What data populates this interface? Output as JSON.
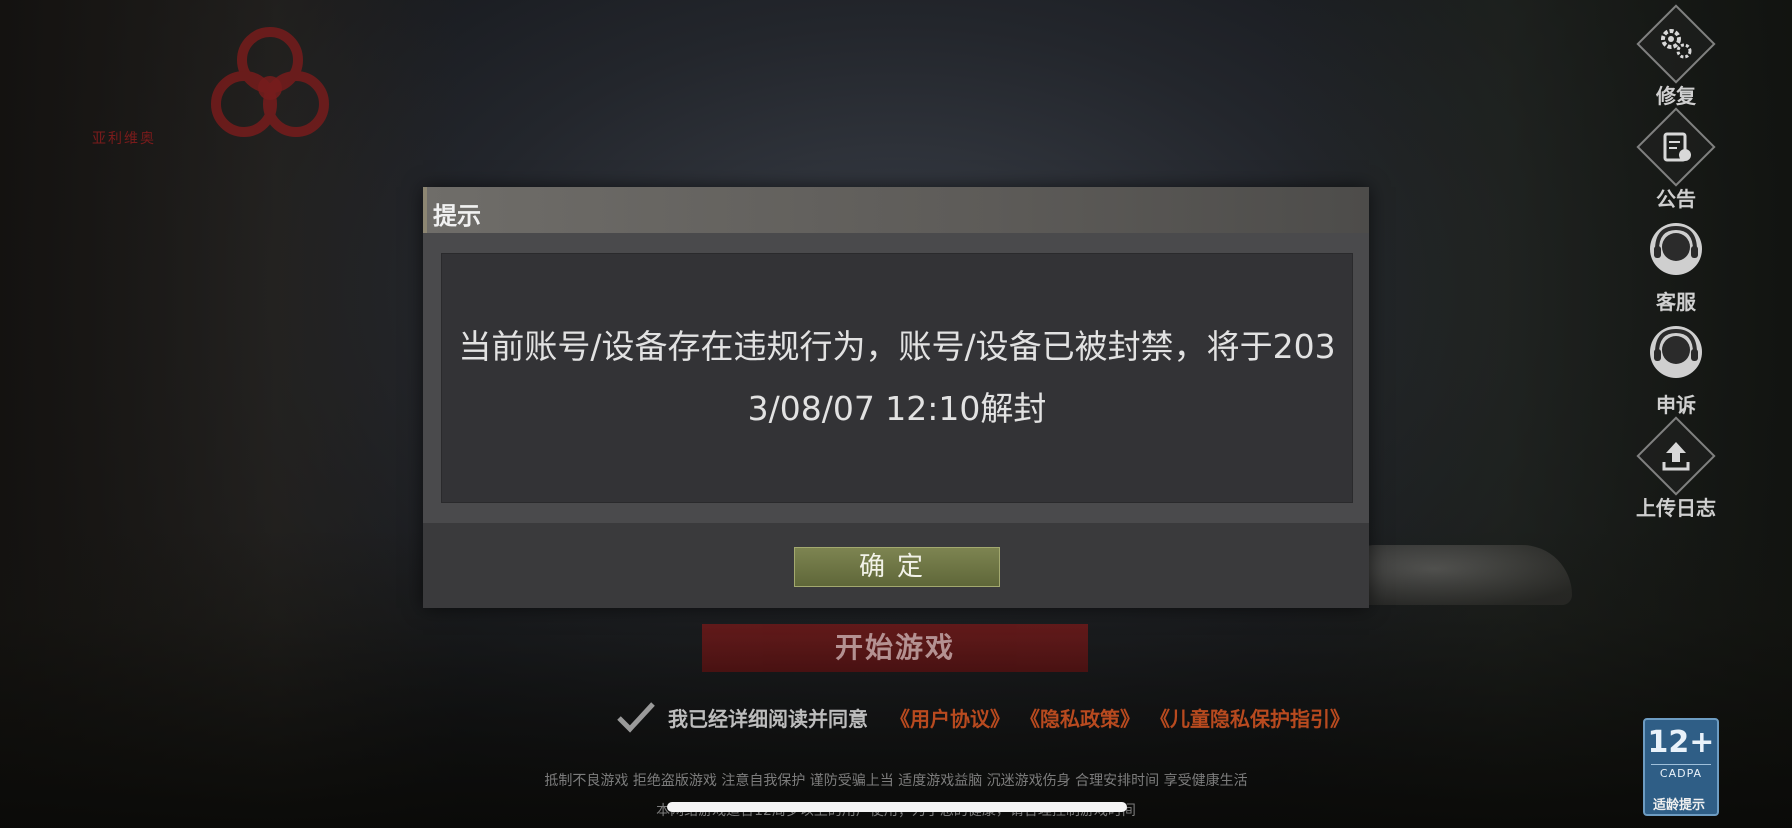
{
  "logo": {
    "text": "亚利维奥"
  },
  "side_menu": [
    {
      "label": "修复",
      "icon": "gears-icon"
    },
    {
      "label": "公告",
      "icon": "announcement-icon"
    },
    {
      "label": "客服",
      "icon": "headset-icon"
    },
    {
      "label": "申诉",
      "icon": "headset-icon"
    },
    {
      "label": "上传日志",
      "icon": "upload-icon"
    }
  ],
  "dialog": {
    "title": "提示",
    "message": "当前账号/设备存在违规行为，账号/设备已被封禁，将于2033/08/07 12:10解封",
    "confirm_label": "确定"
  },
  "start_button": {
    "label": "开始游戏"
  },
  "agreement": {
    "text": "我已经详细阅读并同意",
    "links": [
      "《用户协议》",
      "《隐私政策》",
      "《儿童隐私保护指引》"
    ]
  },
  "health_notice": {
    "line1": "抵制不良游戏 拒绝盗版游戏 注意自我保护 谨防受骗上当 适度游戏益脑 沉迷游戏伤身 合理安排时间 享受健康生活",
    "line2": "本网络游戏适合12周岁以上的用户使用；为了您的健康，请合理控制游戏时间"
  },
  "age_rating": {
    "number": "12+",
    "org": "CADPA",
    "label": "适龄提示"
  },
  "colors": {
    "dialog_bg": "#3a3a3c",
    "confirm_button": "#6f7745",
    "start_button": "#6b1616",
    "link": "#b84a1f",
    "age_badge": "#2f5e86"
  }
}
